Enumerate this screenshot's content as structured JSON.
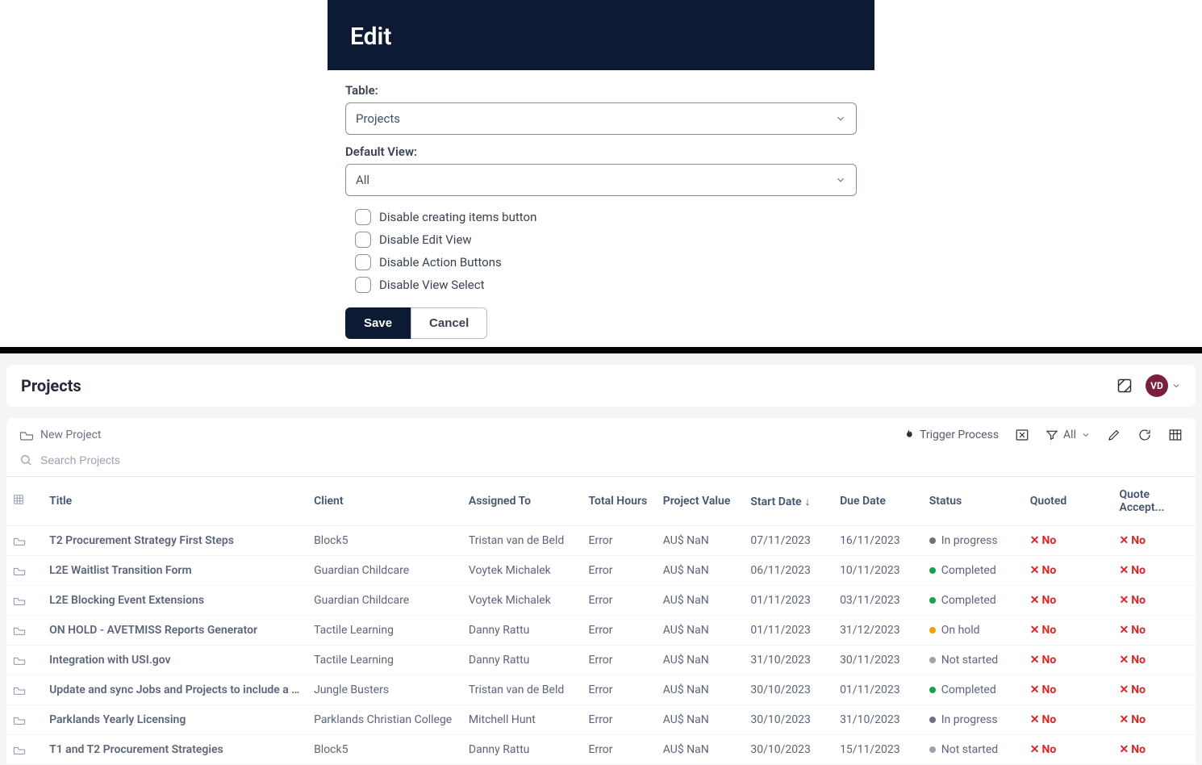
{
  "modal": {
    "title": "Edit",
    "table_label": "Table:",
    "table_value": "Projects",
    "defaultview_label": "Default View:",
    "defaultview_value": "All",
    "checks": {
      "c1": "Disable creating items button",
      "c2": "Disable Edit View",
      "c3": "Disable Action Buttons",
      "c4": "Disable View Select"
    },
    "save": "Save",
    "cancel": "Cancel"
  },
  "page": {
    "title": "Projects",
    "avatar": "VD",
    "new_project": "New Project",
    "trigger_process": "Trigger Process",
    "filter_all": "All",
    "search_placeholder": "Search Projects"
  },
  "columns": {
    "title": "Title",
    "client": "Client",
    "assigned": "Assigned To",
    "hours": "Total Hours",
    "value": "Project Value",
    "start": "Start Date",
    "due": "Due Date",
    "status": "Status",
    "quoted": "Quoted",
    "accept": "Quote Accept..."
  },
  "rows": [
    {
      "title": "T2 Procurement Strategy First Steps",
      "client": "Block5",
      "assigned": "Tristan van de Beld",
      "hours": "Error",
      "value": "AU$ NaN",
      "start": "07/11/2023",
      "due": "16/11/2023",
      "status": "In progress",
      "statusKey": "progress",
      "quoted": "No",
      "accept": "No"
    },
    {
      "title": "L2E Waitlist Transition Form",
      "client": "Guardian Childcare",
      "assigned": "Voytek Michalek",
      "hours": "Error",
      "value": "AU$ NaN",
      "start": "06/11/2023",
      "due": "10/11/2023",
      "status": "Completed",
      "statusKey": "completed",
      "quoted": "No",
      "accept": "No"
    },
    {
      "title": "L2E Blocking Event Extensions",
      "client": "Guardian Childcare",
      "assigned": "Voytek Michalek",
      "hours": "Error",
      "value": "AU$ NaN",
      "start": "01/11/2023",
      "due": "03/11/2023",
      "status": "Completed",
      "statusKey": "completed",
      "quoted": "No",
      "accept": "No"
    },
    {
      "title": "ON HOLD - AVETMISS Reports Generator",
      "client": "Tactile Learning",
      "assigned": "Danny Rattu",
      "hours": "Error",
      "value": "AU$ NaN",
      "start": "01/11/2023",
      "due": "31/12/2023",
      "status": "On hold",
      "statusKey": "hold",
      "quoted": "No",
      "accept": "No"
    },
    {
      "title": "Integration with USI.gov",
      "client": "Tactile Learning",
      "assigned": "Danny Rattu",
      "hours": "Error",
      "value": "AU$ NaN",
      "start": "31/10/2023",
      "due": "30/11/2023",
      "status": "Not started",
      "statusKey": "notstarted",
      "quoted": "No",
      "accept": "No"
    },
    {
      "title": "Update and sync Jobs and Projects to include a sin...",
      "client": "Jungle Busters",
      "assigned": "Tristan van de Beld",
      "hours": "Error",
      "value": "AU$ NaN",
      "start": "30/10/2023",
      "due": "01/11/2023",
      "status": "Completed",
      "statusKey": "completed",
      "quoted": "No",
      "accept": "No"
    },
    {
      "title": "Parklands Yearly Licensing",
      "client": "Parklands Christian College",
      "assigned": "Mitchell Hunt",
      "hours": "Error",
      "value": "AU$ NaN",
      "start": "30/10/2023",
      "due": "31/10/2023",
      "status": "In progress",
      "statusKey": "progress",
      "quoted": "No",
      "accept": "No"
    },
    {
      "title": "T1 and T2 Procurement Strategies",
      "client": "Block5",
      "assigned": "Danny Rattu",
      "hours": "Error",
      "value": "AU$ NaN",
      "start": "30/10/2023",
      "due": "15/11/2023",
      "status": "Not started",
      "statusKey": "notstarted",
      "quoted": "No",
      "accept": "No"
    }
  ]
}
